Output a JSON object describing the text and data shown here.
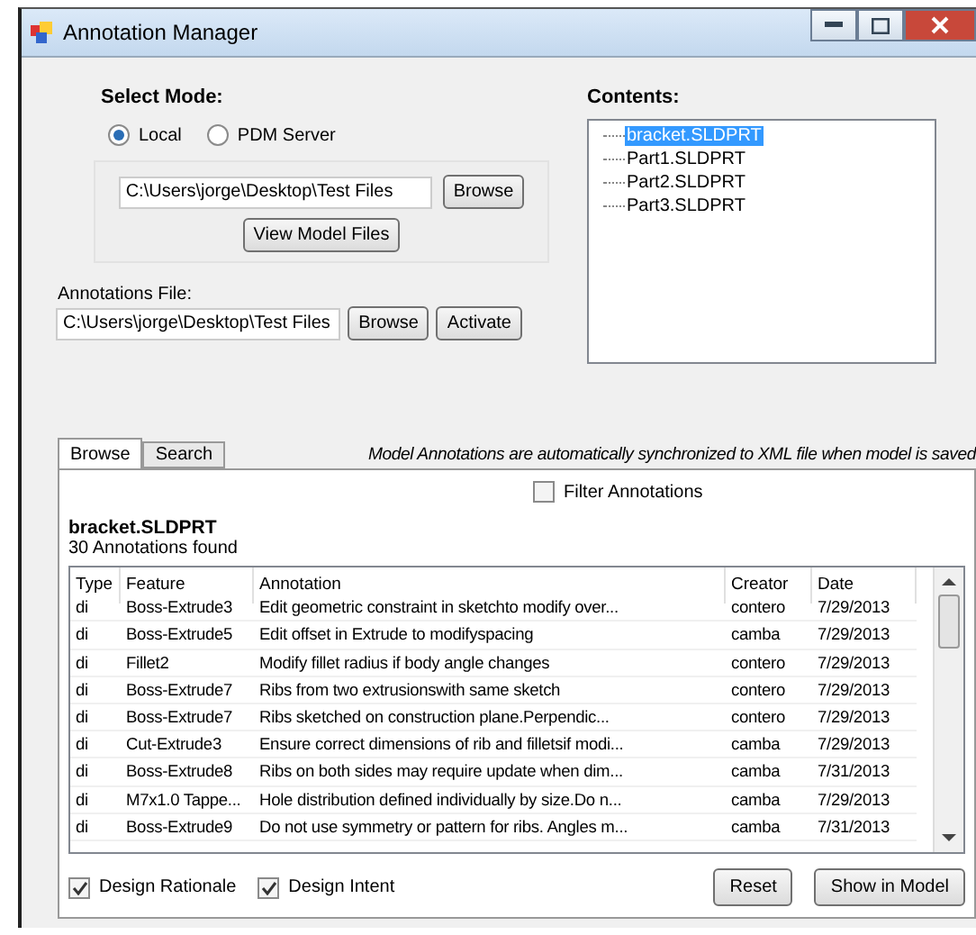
{
  "window": {
    "title": "Annotation Manager"
  },
  "mode": {
    "label": "Select Mode:",
    "options": [
      {
        "label": "Local",
        "selected": true
      },
      {
        "label": "PDM Server",
        "selected": false
      }
    ]
  },
  "model_path": {
    "value": "C:\\Users\\jorge\\Desktop\\Test Files",
    "browse": "Browse",
    "view": "View Model Files"
  },
  "annotations_file": {
    "label": "Annotations File:",
    "value": "C:\\Users\\jorge\\Desktop\\Test Files",
    "browse": "Browse",
    "activate": "Activate"
  },
  "contents": {
    "label": "Contents:",
    "items": [
      {
        "label": "bracket.SLDPRT",
        "selected": true
      },
      {
        "label": "Part1.SLDPRT",
        "selected": false
      },
      {
        "label": "Part2.SLDPRT",
        "selected": false
      },
      {
        "label": "Part3.SLDPRT",
        "selected": false
      }
    ]
  },
  "tabs": [
    {
      "label": "Browse",
      "selected": true
    },
    {
      "label": "Search",
      "selected": false
    }
  ],
  "sync_note": "Model Annotations are automatically synchronized to XML file when model is saved",
  "filter": {
    "label": "Filter Annotations",
    "checked": false
  },
  "model_name": "bracket.SLDPRT",
  "count": "30 Annotations found",
  "table": {
    "columns": [
      "Type",
      "Feature",
      "Annotation",
      "Creator",
      "Date"
    ],
    "rows": [
      [
        "di",
        "Boss-Extrude3",
        "Edit geometric constraint in sketchto modify over...",
        "contero",
        "7/29/2013"
      ],
      [
        "di",
        "Boss-Extrude5",
        "Edit offset in Extrude to modifyspacing",
        "camba",
        "7/29/2013"
      ],
      [
        "di",
        "Fillet2",
        "Modify fillet radius if body angle changes",
        "contero",
        "7/29/2013"
      ],
      [
        "di",
        "Boss-Extrude7",
        "Ribs from two extrusionswith same sketch",
        "contero",
        "7/29/2013"
      ],
      [
        "di",
        "Boss-Extrude7",
        "Ribs sketched on construction plane.Perpendic...",
        "contero",
        "7/29/2013"
      ],
      [
        "di",
        "Cut-Extrude3",
        "Ensure correct dimensions of rib and filletsif modi...",
        "camba",
        "7/29/2013"
      ],
      [
        "di",
        "Boss-Extrude8",
        "Ribs on both sides may require update when dim...",
        "camba",
        "7/31/2013"
      ],
      [
        "di",
        "M7x1.0 Tappe...",
        "Hole distribution defined individually by size.Do n...",
        "camba",
        "7/29/2013"
      ],
      [
        "di",
        "Boss-Extrude9",
        "Do not use symmetry or pattern for ribs. Angles m...",
        "camba",
        "7/31/2013"
      ]
    ]
  },
  "options": [
    {
      "label": "Design Rationale",
      "checked": true
    },
    {
      "label": "Design Intent",
      "checked": true
    }
  ],
  "buttons": [
    "Reset",
    "Show in Model"
  ]
}
